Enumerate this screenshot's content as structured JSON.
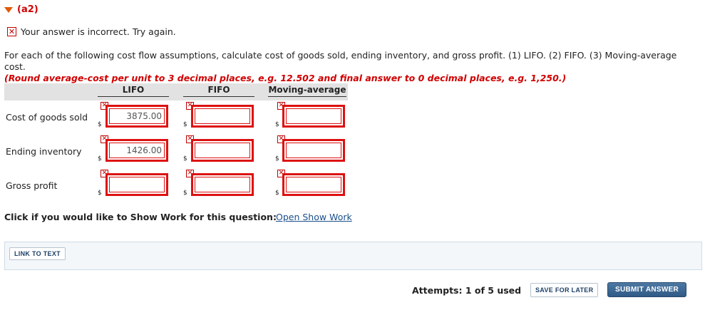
{
  "section": {
    "label": "(a2)"
  },
  "feedback": {
    "icon": "x-icon",
    "message": "Your answer is incorrect.  Try again."
  },
  "instructions": {
    "text": "For each of the following cost flow assumptions, calculate cost of goods sold, ending inventory, and gross profit. (1) LIFO. (2) FIFO. (3) Moving-average cost.",
    "note": "(Round average-cost per unit to 3 decimal places, e.g. 12.502 and final answer to 0 decimal places, e.g. 1,250.)"
  },
  "table": {
    "columns": [
      "LIFO",
      "FIFO",
      "Moving-average"
    ],
    "currency": "$",
    "rows": [
      {
        "label": "Cost of goods sold",
        "values": [
          "3875.00",
          "",
          ""
        ]
      },
      {
        "label": "Ending inventory",
        "values": [
          "1426.00",
          "",
          ""
        ]
      },
      {
        "label": "Gross profit",
        "values": [
          "",
          "",
          ""
        ]
      }
    ]
  },
  "show_work": {
    "prompt": "Click if you would like to Show Work for this question:",
    "link": "Open Show Work"
  },
  "panel": {
    "link_to_text": "LINK TO TEXT"
  },
  "footer": {
    "attempts": "Attempts: 1 of 5 used",
    "save": "SAVE FOR LATER",
    "submit": "SUBMIT ANSWER"
  },
  "colors": {
    "error_red": "#dd1111",
    "heading_red": "#d00000",
    "link_blue": "#1a4f8c",
    "submit_blue": "#2e5a86"
  }
}
